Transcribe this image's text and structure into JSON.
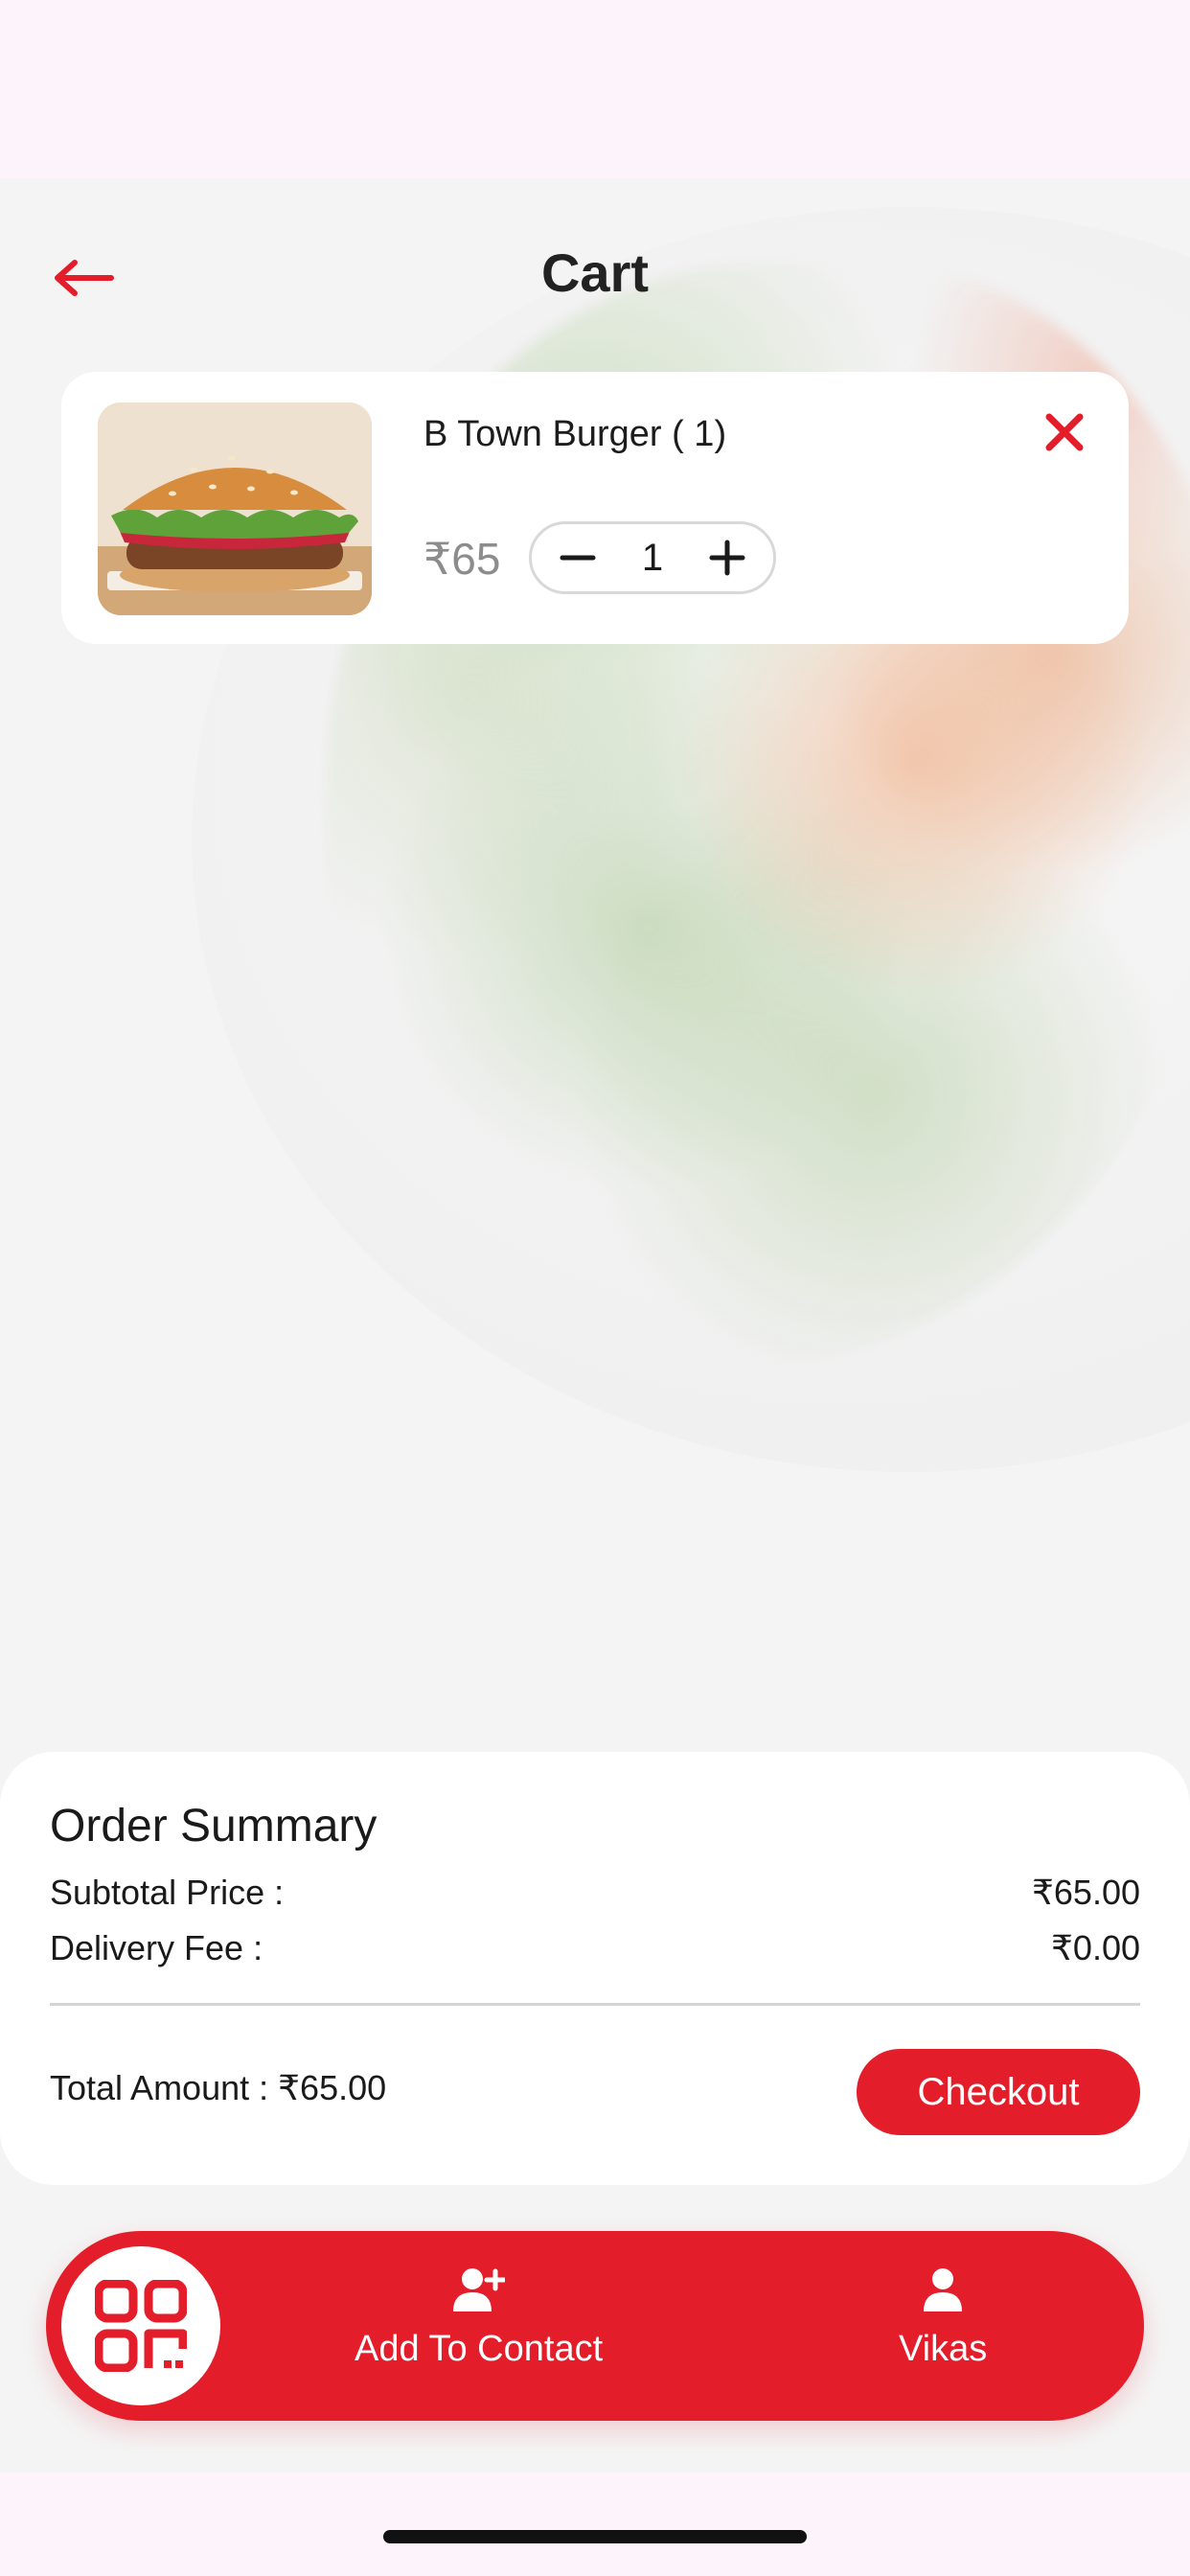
{
  "header": {
    "title": "Cart",
    "back_icon": "arrow-left-icon"
  },
  "cart": {
    "items": [
      {
        "name": "B Town Burger ( 1)",
        "price": "₹65",
        "quantity": "1",
        "image": "burger-photo",
        "remove_icon": "close-icon"
      }
    ]
  },
  "summary": {
    "title": "Order Summary",
    "subtotal_label": "Subtotal Price :",
    "subtotal_value": "₹65.00",
    "delivery_label": "Delivery Fee :",
    "delivery_value": "₹0.00",
    "total_label": "Total Amount :",
    "total_value": "₹65.00",
    "checkout_label": "Checkout"
  },
  "bottom_nav": {
    "qr_icon": "qr-code-icon",
    "add_contact_label": "Add To Contact",
    "add_contact_icon": "user-plus-icon",
    "profile_label": "Vikas",
    "profile_icon": "user-icon"
  },
  "colors": {
    "accent": "#e31e2a",
    "background": "#fdf3fb",
    "card": "#ffffff"
  }
}
